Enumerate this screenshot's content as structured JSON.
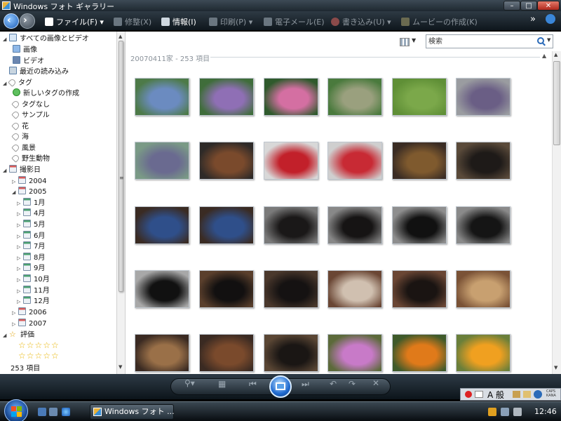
{
  "window": {
    "title": "Windows フォト ギャラリー",
    "buttons": {
      "minimize": "–",
      "maximize": "□",
      "close": "✕"
    }
  },
  "toolbar": {
    "file": "ファイル(F)",
    "fix": "修整(X)",
    "info": "情報(I)",
    "print": "印刷(P)",
    "email": "電子メール(E)",
    "burn": "書き込み(U)",
    "movie": "ムービーの作成(K)",
    "more": "»"
  },
  "nav": {
    "all": "すべての画像とビデオ",
    "images": "画像",
    "videos": "ビデオ",
    "recent": "最近の読み込み",
    "tags": "タグ",
    "new_tag": "新しいタグの作成",
    "no_tag": "タグなし",
    "tag_sample": "サンプル",
    "tag_flower": "花",
    "tag_sea": "海",
    "tag_scenery": "風景",
    "tag_wildlife": "野生動物",
    "date_taken": "撮影日",
    "y2004": "2004",
    "y2005": "2005",
    "months": [
      "1月",
      "4月",
      "5月",
      "6月",
      "7月",
      "8月",
      "9月",
      "10月",
      "11月",
      "12月"
    ],
    "y2006": "2006",
    "y2007": "2007",
    "rating": "評価",
    "stars_row1": "☆☆☆☆☆",
    "stars_row2": "☆☆☆☆☆"
  },
  "status": {
    "count": "253 項目"
  },
  "content": {
    "search_placeholder": "検索",
    "group_header": "20070411家 - 253 項目"
  },
  "thumbnails": [
    [
      "#4d7a48",
      "#6b8bc0"
    ],
    [
      "#3f6d3a",
      "#8f6fb5"
    ],
    [
      "#2f5a2c",
      "#d46fa2"
    ],
    [
      "#4a7a3d",
      "#9aa07e"
    ],
    [
      "#5f8f36",
      "#7ba84a"
    ],
    [
      "#9a9ca0",
      "#6a5e85"
    ],
    [
      "#7a9a86",
      "#6a6a90"
    ],
    [
      "#2e2a28",
      "#7a4a2c"
    ],
    [
      "#d8d8d8",
      "#c2202a"
    ],
    [
      "#cfcfcf",
      "#c82a34"
    ],
    [
      "#3a2c24",
      "#7f5a2e"
    ],
    [
      "#5a4a3a",
      "#1e1a18"
    ],
    [
      "#3a2b23",
      "#2f4f8a"
    ],
    [
      "#3a2b23",
      "#2f4f8a"
    ],
    [
      "#7a7a7a",
      "#1a1818"
    ],
    [
      "#888888",
      "#161414"
    ],
    [
      "#8e8e8e",
      "#111"
    ],
    [
      "#8a8a8a",
      "#151515"
    ],
    [
      "#a8a8a8",
      "#111"
    ],
    [
      "#5a3f2c",
      "#121010"
    ],
    [
      "#4a382c",
      "#151212"
    ],
    [
      "#6a4634",
      "#d0c0b0"
    ],
    [
      "#6a4634",
      "#1a1412"
    ],
    [
      "#7a5236",
      "#c8a070"
    ],
    [
      "#3a2a22",
      "#9a7048"
    ],
    [
      "#3a2a22",
      "#7a4a2c"
    ],
    [
      "#5a4634",
      "#1a1614"
    ],
    [
      "#5c6a3a",
      "#c87ac8"
    ],
    [
      "#3f5a2a",
      "#e07a1a"
    ],
    [
      "#6a7f3a",
      "#f0a020"
    ]
  ],
  "taskbar": {
    "window_button": "Windows フォト ...",
    "clock": "12:46"
  },
  "langbar": {
    "mode": "A 般",
    "caps": "CAPS KANA"
  }
}
